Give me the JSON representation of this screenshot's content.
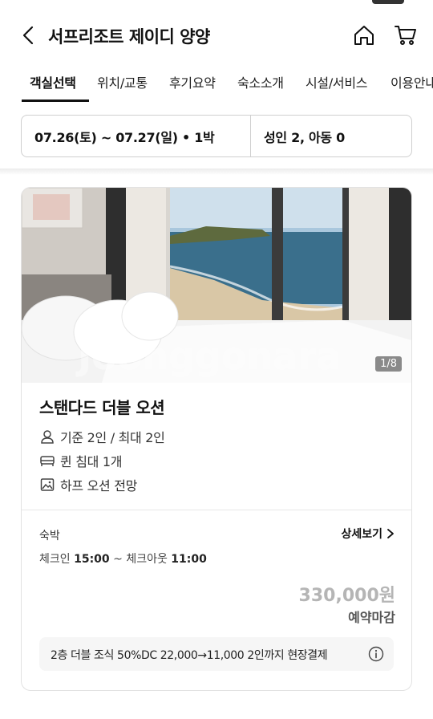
{
  "header": {
    "title": "서프리조트 제이디 양양"
  },
  "tabs": [
    {
      "label": "객실선택",
      "active": true
    },
    {
      "label": "위치/교통"
    },
    {
      "label": "후기요약"
    },
    {
      "label": "숙소소개"
    },
    {
      "label": "시설/서비스"
    },
    {
      "label": "이용안내"
    }
  ],
  "search": {
    "dates": "07.26(토) ~ 07.27(일) • 1박",
    "guests": "성인 2, 아동 0"
  },
  "room": {
    "photo_counter": "1/8",
    "watermark": "Joonggonara",
    "name": "스탠다드 더블 오션",
    "capacity": "기준 2인 / 최대 2인",
    "bed": "퀸 침대 1개",
    "view": "하프 오션 전망",
    "stay_label": "숙박",
    "detail_label": "상세보기",
    "checkin_label": "체크인",
    "checkin_time": "15:00",
    "checkout_label": "체크아웃",
    "checkout_time": "11:00",
    "price": "330,000원",
    "status": "예약마감",
    "notice": "2층 더블 조식 50%DC 22,000→11,000 2인까지 현장결제"
  },
  "colors": {
    "accent": "#111111",
    "price_disabled": "#b5b5b5"
  }
}
